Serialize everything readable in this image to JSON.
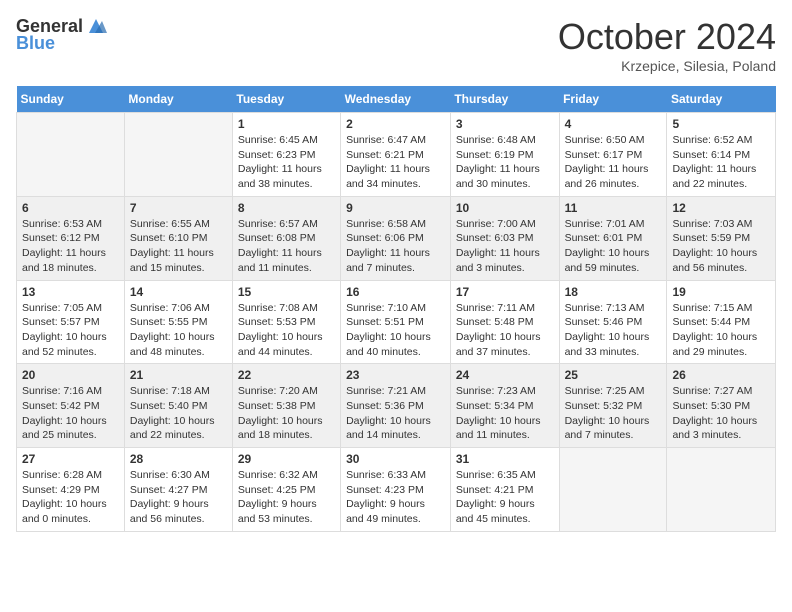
{
  "header": {
    "logo_general": "General",
    "logo_blue": "Blue",
    "month": "October 2024",
    "location": "Krzepice, Silesia, Poland"
  },
  "weekdays": [
    "Sunday",
    "Monday",
    "Tuesday",
    "Wednesday",
    "Thursday",
    "Friday",
    "Saturday"
  ],
  "weeks": [
    [
      {
        "day": "",
        "sunrise": "",
        "sunset": "",
        "daylight": ""
      },
      {
        "day": "",
        "sunrise": "",
        "sunset": "",
        "daylight": ""
      },
      {
        "day": "1",
        "sunrise": "Sunrise: 6:45 AM",
        "sunset": "Sunset: 6:23 PM",
        "daylight": "Daylight: 11 hours and 38 minutes."
      },
      {
        "day": "2",
        "sunrise": "Sunrise: 6:47 AM",
        "sunset": "Sunset: 6:21 PM",
        "daylight": "Daylight: 11 hours and 34 minutes."
      },
      {
        "day": "3",
        "sunrise": "Sunrise: 6:48 AM",
        "sunset": "Sunset: 6:19 PM",
        "daylight": "Daylight: 11 hours and 30 minutes."
      },
      {
        "day": "4",
        "sunrise": "Sunrise: 6:50 AM",
        "sunset": "Sunset: 6:17 PM",
        "daylight": "Daylight: 11 hours and 26 minutes."
      },
      {
        "day": "5",
        "sunrise": "Sunrise: 6:52 AM",
        "sunset": "Sunset: 6:14 PM",
        "daylight": "Daylight: 11 hours and 22 minutes."
      }
    ],
    [
      {
        "day": "6",
        "sunrise": "Sunrise: 6:53 AM",
        "sunset": "Sunset: 6:12 PM",
        "daylight": "Daylight: 11 hours and 18 minutes."
      },
      {
        "day": "7",
        "sunrise": "Sunrise: 6:55 AM",
        "sunset": "Sunset: 6:10 PM",
        "daylight": "Daylight: 11 hours and 15 minutes."
      },
      {
        "day": "8",
        "sunrise": "Sunrise: 6:57 AM",
        "sunset": "Sunset: 6:08 PM",
        "daylight": "Daylight: 11 hours and 11 minutes."
      },
      {
        "day": "9",
        "sunrise": "Sunrise: 6:58 AM",
        "sunset": "Sunset: 6:06 PM",
        "daylight": "Daylight: 11 hours and 7 minutes."
      },
      {
        "day": "10",
        "sunrise": "Sunrise: 7:00 AM",
        "sunset": "Sunset: 6:03 PM",
        "daylight": "Daylight: 11 hours and 3 minutes."
      },
      {
        "day": "11",
        "sunrise": "Sunrise: 7:01 AM",
        "sunset": "Sunset: 6:01 PM",
        "daylight": "Daylight: 10 hours and 59 minutes."
      },
      {
        "day": "12",
        "sunrise": "Sunrise: 7:03 AM",
        "sunset": "Sunset: 5:59 PM",
        "daylight": "Daylight: 10 hours and 56 minutes."
      }
    ],
    [
      {
        "day": "13",
        "sunrise": "Sunrise: 7:05 AM",
        "sunset": "Sunset: 5:57 PM",
        "daylight": "Daylight: 10 hours and 52 minutes."
      },
      {
        "day": "14",
        "sunrise": "Sunrise: 7:06 AM",
        "sunset": "Sunset: 5:55 PM",
        "daylight": "Daylight: 10 hours and 48 minutes."
      },
      {
        "day": "15",
        "sunrise": "Sunrise: 7:08 AM",
        "sunset": "Sunset: 5:53 PM",
        "daylight": "Daylight: 10 hours and 44 minutes."
      },
      {
        "day": "16",
        "sunrise": "Sunrise: 7:10 AM",
        "sunset": "Sunset: 5:51 PM",
        "daylight": "Daylight: 10 hours and 40 minutes."
      },
      {
        "day": "17",
        "sunrise": "Sunrise: 7:11 AM",
        "sunset": "Sunset: 5:48 PM",
        "daylight": "Daylight: 10 hours and 37 minutes."
      },
      {
        "day": "18",
        "sunrise": "Sunrise: 7:13 AM",
        "sunset": "Sunset: 5:46 PM",
        "daylight": "Daylight: 10 hours and 33 minutes."
      },
      {
        "day": "19",
        "sunrise": "Sunrise: 7:15 AM",
        "sunset": "Sunset: 5:44 PM",
        "daylight": "Daylight: 10 hours and 29 minutes."
      }
    ],
    [
      {
        "day": "20",
        "sunrise": "Sunrise: 7:16 AM",
        "sunset": "Sunset: 5:42 PM",
        "daylight": "Daylight: 10 hours and 25 minutes."
      },
      {
        "day": "21",
        "sunrise": "Sunrise: 7:18 AM",
        "sunset": "Sunset: 5:40 PM",
        "daylight": "Daylight: 10 hours and 22 minutes."
      },
      {
        "day": "22",
        "sunrise": "Sunrise: 7:20 AM",
        "sunset": "Sunset: 5:38 PM",
        "daylight": "Daylight: 10 hours and 18 minutes."
      },
      {
        "day": "23",
        "sunrise": "Sunrise: 7:21 AM",
        "sunset": "Sunset: 5:36 PM",
        "daylight": "Daylight: 10 hours and 14 minutes."
      },
      {
        "day": "24",
        "sunrise": "Sunrise: 7:23 AM",
        "sunset": "Sunset: 5:34 PM",
        "daylight": "Daylight: 10 hours and 11 minutes."
      },
      {
        "day": "25",
        "sunrise": "Sunrise: 7:25 AM",
        "sunset": "Sunset: 5:32 PM",
        "daylight": "Daylight: 10 hours and 7 minutes."
      },
      {
        "day": "26",
        "sunrise": "Sunrise: 7:27 AM",
        "sunset": "Sunset: 5:30 PM",
        "daylight": "Daylight: 10 hours and 3 minutes."
      }
    ],
    [
      {
        "day": "27",
        "sunrise": "Sunrise: 6:28 AM",
        "sunset": "Sunset: 4:29 PM",
        "daylight": "Daylight: 10 hours and 0 minutes."
      },
      {
        "day": "28",
        "sunrise": "Sunrise: 6:30 AM",
        "sunset": "Sunset: 4:27 PM",
        "daylight": "Daylight: 9 hours and 56 minutes."
      },
      {
        "day": "29",
        "sunrise": "Sunrise: 6:32 AM",
        "sunset": "Sunset: 4:25 PM",
        "daylight": "Daylight: 9 hours and 53 minutes."
      },
      {
        "day": "30",
        "sunrise": "Sunrise: 6:33 AM",
        "sunset": "Sunset: 4:23 PM",
        "daylight": "Daylight: 9 hours and 49 minutes."
      },
      {
        "day": "31",
        "sunrise": "Sunrise: 6:35 AM",
        "sunset": "Sunset: 4:21 PM",
        "daylight": "Daylight: 9 hours and 45 minutes."
      },
      {
        "day": "",
        "sunrise": "",
        "sunset": "",
        "daylight": ""
      },
      {
        "day": "",
        "sunrise": "",
        "sunset": "",
        "daylight": ""
      }
    ]
  ]
}
